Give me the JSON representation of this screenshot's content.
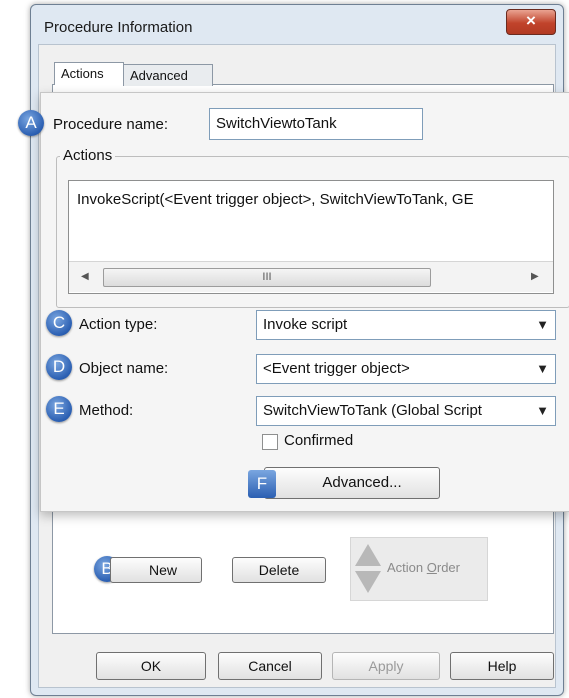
{
  "dialog": {
    "title": "Procedure Information",
    "close_glyph": "×"
  },
  "tabs": [
    {
      "label": "Actions"
    },
    {
      "label": "Advanced"
    }
  ],
  "procedure": {
    "badge": "A",
    "label": "Procedure name:",
    "value": "SwitchViewtoTank"
  },
  "actions_group": {
    "title": "Actions",
    "items": [
      "InvokeScript(<Event trigger object>, SwitchViewToTank, GE"
    ],
    "scroll_thumb": "III"
  },
  "action_type": {
    "badge": "C",
    "label": "Action type:",
    "value": "Invoke script"
  },
  "object_name": {
    "badge": "D",
    "label": "Object name:",
    "value": "<Event trigger object>"
  },
  "method": {
    "badge": "E",
    "label": "Method:",
    "value": "SwitchViewToTank (Global Script"
  },
  "confirmed": {
    "label": "Confirmed",
    "checked": false
  },
  "advanced_button": {
    "badge": "F",
    "label": "Advanced..."
  },
  "list_buttons": {
    "new_badge": "B",
    "new_label": "New",
    "delete_label": "Delete",
    "order_label_pre": "Action ",
    "order_label_u": "O",
    "order_label_post": "rder"
  },
  "footer": {
    "ok": "OK",
    "cancel": "Cancel",
    "apply": "Apply",
    "help": "Help"
  },
  "colors": {
    "badge_blue": "#2b5fb2",
    "close_red": "#c1432b"
  }
}
